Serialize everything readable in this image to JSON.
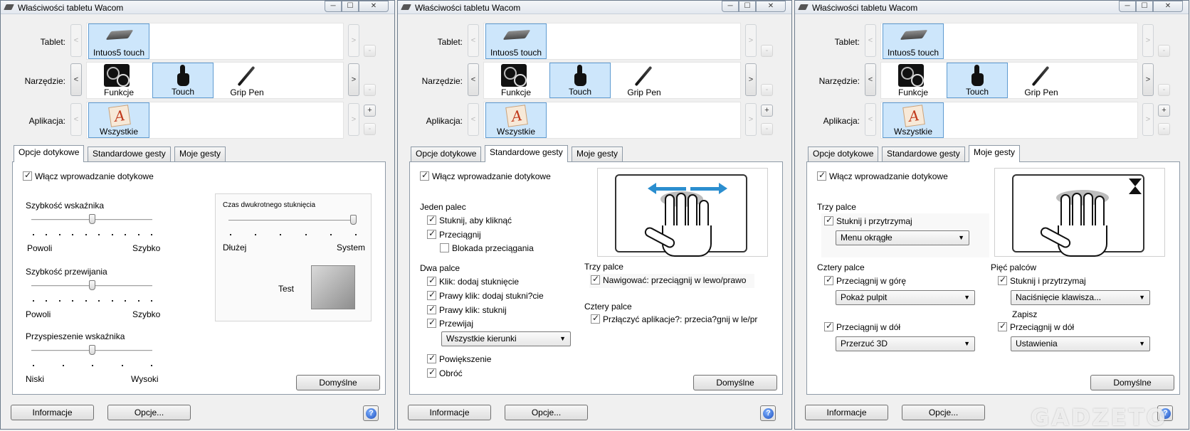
{
  "window_title": "Właściwości tabletu Wacom",
  "rows": {
    "tablet_label": "Tablet:",
    "tool_label": "Narzędzie:",
    "app_label": "Aplikacja:"
  },
  "tablet_item": "Intuos5 touch",
  "tools": [
    "Funkcje",
    "Touch",
    "Grip Pen"
  ],
  "app_item": "Wszystkie",
  "nav": {
    "prev": "<",
    "next": ">",
    "plus": "+",
    "minus": "-"
  },
  "tabs": [
    "Opcje dotykowe",
    "Standardowe gesty",
    "Moje gesty"
  ],
  "enable_touch": "Włącz wprowadzanie dotykowe",
  "footer": {
    "info": "Informacje",
    "options": "Opcje...",
    "help": "?",
    "default": "Domyślne"
  },
  "panel1": {
    "pointer_speed": "Szybkość wskaźnika",
    "slow": "Powoli",
    "fast": "Szybko",
    "scroll_speed": "Szybkość przewijania",
    "acceleration": "Przyspieszenie wskaźnika",
    "low": "Niski",
    "high": "Wysoki",
    "double_tap": "Czas dwukrotnego stuknięcia",
    "longer": "Dłużej",
    "system": "System",
    "test": "Test",
    "pointer_speed_value": 0.5,
    "scroll_speed_value": 0.5,
    "acceleration_value": 0.5,
    "double_tap_value": 1.0
  },
  "panel2": {
    "one_finger": "Jeden palec",
    "tap_click": "Stuknij, aby kliknąć",
    "drag": "Przeciągnij",
    "drag_lock": "Blokada przeciągania",
    "two_fingers": "Dwa palce",
    "click_add_tap": "Klik: dodaj stuknięcie",
    "right_click_add": "Prawy klik: dodaj stukni?cie",
    "right_click_tap": "Prawy klik: stuknij",
    "scroll": "Przewijaj",
    "scroll_dir": "Wszystkie kierunki",
    "zoom": "Powiększenie",
    "rotate": "Obróć",
    "three_fingers": "Trzy palce",
    "navigate": "Nawigować: przeciągnij w lewo/prawo",
    "four_fingers": "Cztery palce",
    "switch_apps": "Przłączyć aplikacje?: przecia?gnij w le/pr"
  },
  "panel3": {
    "three_fingers": "Trzy palce",
    "tap_hold": "Stuknij i przytrzymaj",
    "radial_menu": "Menu okrągłe",
    "four_fingers": "Cztery palce",
    "drag_up": "Przeciągnij w górę",
    "show_desktop": "Pokaż pulpit",
    "drag_down": "Przeciągnij w dół",
    "flip3d": "Przerzuć 3D",
    "five_fingers": "Pięć palców",
    "tap_hold5": "Stuknij i przytrzymaj",
    "keystroke": "Naciśnięcie klawisza...",
    "save": "Zapisz",
    "drag_down5": "Przeciągnij w dół",
    "settings": "Ustawienia"
  },
  "watermark": "GADZETO"
}
